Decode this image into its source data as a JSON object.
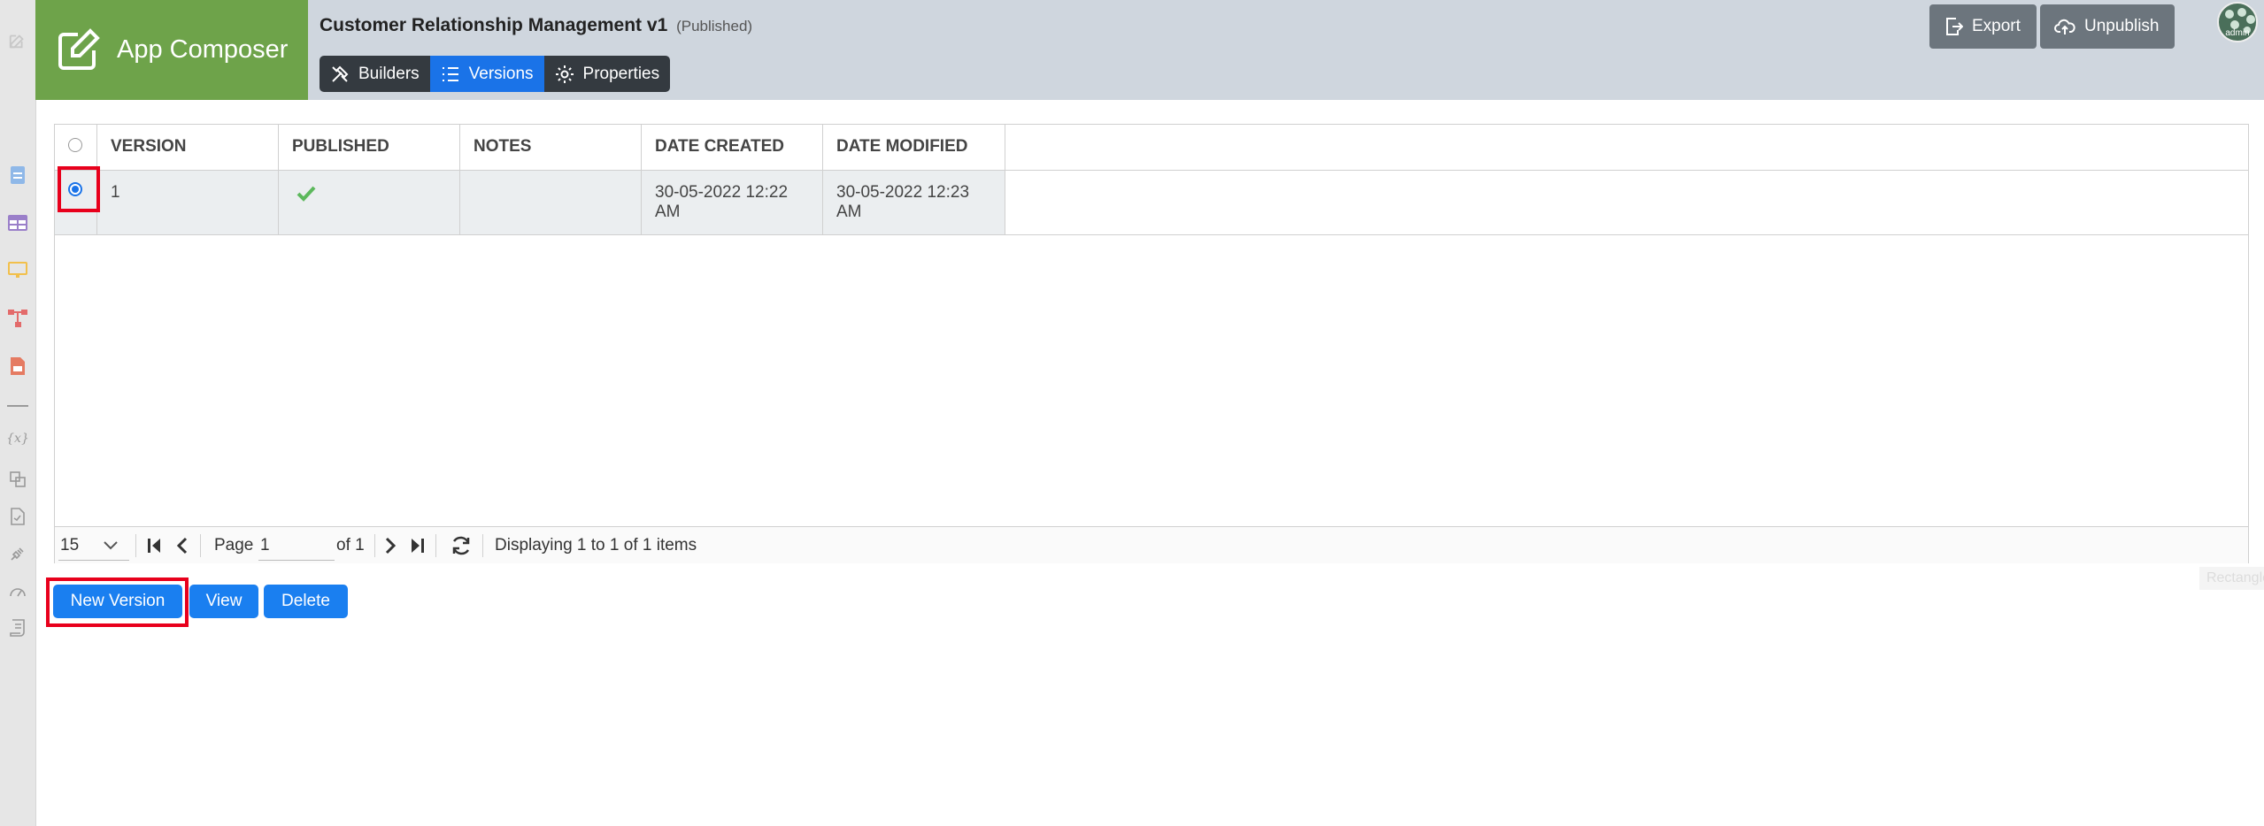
{
  "brand": {
    "name": "App Composer"
  },
  "app": {
    "title": "Customer Relationship Management v1",
    "status": "(Published)"
  },
  "tabs": [
    {
      "label": "Builders",
      "icon": "tools-icon",
      "active": false
    },
    {
      "label": "Versions",
      "icon": "list-icon",
      "active": true
    },
    {
      "label": "Properties",
      "icon": "gear-icon",
      "active": false
    }
  ],
  "header_buttons": {
    "export": "Export",
    "unpublish": "Unpublish"
  },
  "user": {
    "avatar_label": "admin"
  },
  "sidebar_icons": [
    "edit-icon",
    "form-icon",
    "datalist-icon",
    "userview-icon",
    "process-icon",
    "report-icon",
    "variable-icon",
    "resource-icon",
    "document-icon",
    "plugin-icon",
    "performance-icon",
    "log-icon"
  ],
  "table": {
    "columns": [
      "VERSION",
      "PUBLISHED",
      "NOTES",
      "DATE CREATED",
      "DATE MODIFIED"
    ],
    "rows": [
      {
        "selected": true,
        "version": "1",
        "published": true,
        "notes": "",
        "date_created": "30-05-2022 12:22 AM",
        "date_modified": "30-05-2022 12:23 AM"
      }
    ]
  },
  "pager": {
    "page_size": "15",
    "page_label": "Page",
    "page_value": "1",
    "of_label": "of 1",
    "display_text": "Displaying 1 to 1 of 1 items"
  },
  "overlay_label": "Rectangle",
  "actions": {
    "new_version": "New Version",
    "view": "View",
    "delete": "Delete"
  },
  "colors": {
    "brand": "#6ea34a",
    "header": "#cfd6de",
    "accent": "#1a7ff0",
    "highlight": "#e8001c"
  }
}
